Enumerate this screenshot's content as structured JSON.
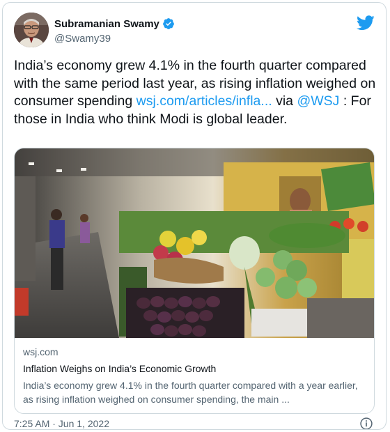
{
  "author": {
    "display_name": "Subramanian Swamy",
    "handle": "@Swamy39"
  },
  "tweet": {
    "text_1": "India’s economy grew 4.1% in the fourth quarter compared with the same period last year, as rising inflation weighed on consumer spending ",
    "link": "wsj.com/articles/infla...",
    "text_2": " via ",
    "mention": "@WSJ",
    "text_3": " : For those in India who think Modi is global leader."
  },
  "link_card": {
    "domain": "wsj.com",
    "title": "Inflation Weighs on India’s Economic Growth",
    "description": "India’s economy grew 4.1% in the fourth quarter compared with a year earlier, as rising inflation weighed on consumer spending, the main ..."
  },
  "footer": {
    "timestamp": "7:25 AM · Jun 1, 2022"
  },
  "icons": {
    "verified": "verified-badge-icon",
    "platform": "twitter-bird-icon",
    "info": "info-icon"
  },
  "colors": {
    "accent": "#1d9bf0",
    "secondary_text": "#536471",
    "border": "#cfd9de"
  }
}
